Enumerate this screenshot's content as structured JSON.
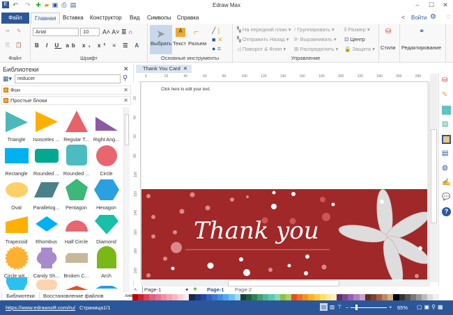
{
  "app": {
    "title": "Edraw Max"
  },
  "menu": {
    "file": "Файл",
    "tabs": [
      "Главная",
      "Вставка",
      "Конструктор",
      "Вид",
      "Символы",
      "Справка"
    ],
    "login": "Войти"
  },
  "ribbon": {
    "file_group": "Файл",
    "font": {
      "name": "Arial",
      "size": "10",
      "label": "Шрифт"
    },
    "tools": {
      "select": "Выбрать",
      "text": "Текст",
      "connector": "Разъем",
      "label": "Основные инструменты"
    },
    "arrange": {
      "bring_front": "На передний план",
      "send_back": "Отправить Назад",
      "rotate": "Поворот & Флип",
      "group": "Группировать",
      "align": "Выравнивать",
      "distribute": "Распределить",
      "size": "Размер",
      "center": "Центр",
      "protect": "Защита",
      "label": "Управление"
    },
    "styles": "Стили",
    "editing": "Редактирование"
  },
  "library": {
    "title": "Библиотеки",
    "search": "reducer",
    "sections": [
      "Фон",
      "Простые блоки"
    ],
    "shapes": [
      "Triangle",
      "Isosceles ...",
      "Regular T...",
      "Right Ang...",
      "Rectangle",
      "Rounded ...",
      "Rounded ...",
      "Circle",
      "Oval",
      "Parallelog...",
      "Pentagon",
      "Hexagon",
      "Trapezoid",
      "Rhombus",
      "Half Circle",
      "Diamond",
      "Circle wit...",
      "Candy Sh...",
      "Broken C...",
      "Arch"
    ],
    "bottom_tabs": [
      "Библиотеки",
      "Восстановление файлов"
    ]
  },
  "document": {
    "tab": "Thank You Card",
    "placeholder": "Click here to edit your text.",
    "card_text": "Thank you",
    "ruler_h": [
      "0",
      "20",
      "40",
      "60",
      "80",
      "100",
      "120",
      "140",
      "160",
      "180",
      "200",
      "220",
      "240",
      "260",
      "280"
    ],
    "ruler_v": [
      "20",
      "40",
      "60",
      "80",
      "100",
      "120",
      "140",
      "160",
      "180",
      "200"
    ]
  },
  "pages": {
    "selector": "Page-1",
    "tabs": [
      "Page-1",
      "Page-2"
    ],
    "fill_label": "ливка"
  },
  "status": {
    "url": "https://www.edrawsoft.com/ru/",
    "page": "Страница1/1",
    "zoom": "65%"
  },
  "colors": {
    "accent": "#2b579a",
    "card": "#a02828"
  }
}
